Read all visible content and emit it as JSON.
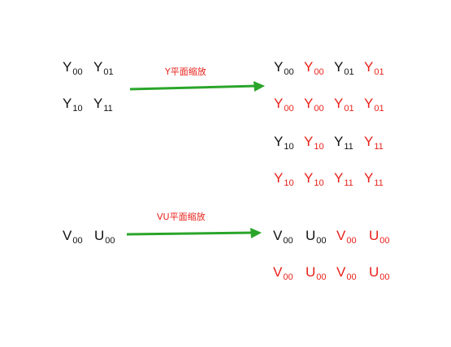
{
  "colors": {
    "red": "#e8201a",
    "black": "#111111",
    "arrow": "#2aa52a"
  },
  "y_section": {
    "arrow_label": "Y平面缩放",
    "source": [
      [
        {
          "l": "Y",
          "s": "00",
          "c": "black"
        },
        {
          "l": "Y",
          "s": "01",
          "c": "black"
        }
      ],
      [
        {
          "l": "Y",
          "s": "10",
          "c": "black"
        },
        {
          "l": "Y",
          "s": "11",
          "c": "black"
        }
      ]
    ],
    "target": [
      [
        {
          "l": "Y",
          "s": "00",
          "c": "black"
        },
        {
          "l": "Y",
          "s": "00",
          "c": "red"
        },
        {
          "l": "Y",
          "s": "01",
          "c": "black"
        },
        {
          "l": "Y",
          "s": "01",
          "c": "red"
        }
      ],
      [
        {
          "l": "Y",
          "s": "00",
          "c": "red"
        },
        {
          "l": "Y",
          "s": "00",
          "c": "red"
        },
        {
          "l": "Y",
          "s": "01",
          "c": "red"
        },
        {
          "l": "Y",
          "s": "01",
          "c": "red"
        }
      ],
      [
        {
          "l": "Y",
          "s": "10",
          "c": "black"
        },
        {
          "l": "Y",
          "s": "10",
          "c": "red"
        },
        {
          "l": "Y",
          "s": "11",
          "c": "black"
        },
        {
          "l": "Y",
          "s": "11",
          "c": "red"
        }
      ],
      [
        {
          "l": "Y",
          "s": "10",
          "c": "red"
        },
        {
          "l": "Y",
          "s": "10",
          "c": "red"
        },
        {
          "l": "Y",
          "s": "11",
          "c": "red"
        },
        {
          "l": "Y",
          "s": "11",
          "c": "red"
        }
      ]
    ]
  },
  "vu_section": {
    "arrow_label": "VU平面缩放",
    "source": [
      [
        {
          "l": "V",
          "s": "00",
          "c": "black"
        },
        {
          "l": "U",
          "s": "00",
          "c": "black"
        }
      ]
    ],
    "target": [
      [
        {
          "l": "V",
          "s": "00",
          "c": "black"
        },
        {
          "l": "U",
          "s": "00",
          "c": "black"
        },
        {
          "l": "V",
          "s": "00",
          "c": "red"
        },
        {
          "l": "U",
          "s": "00",
          "c": "red"
        }
      ],
      [
        {
          "l": "V",
          "s": "00",
          "c": "red"
        },
        {
          "l": "U",
          "s": "00",
          "c": "red"
        },
        {
          "l": "V",
          "s": "00",
          "c": "red"
        },
        {
          "l": "U",
          "s": "00",
          "c": "red"
        }
      ]
    ]
  }
}
